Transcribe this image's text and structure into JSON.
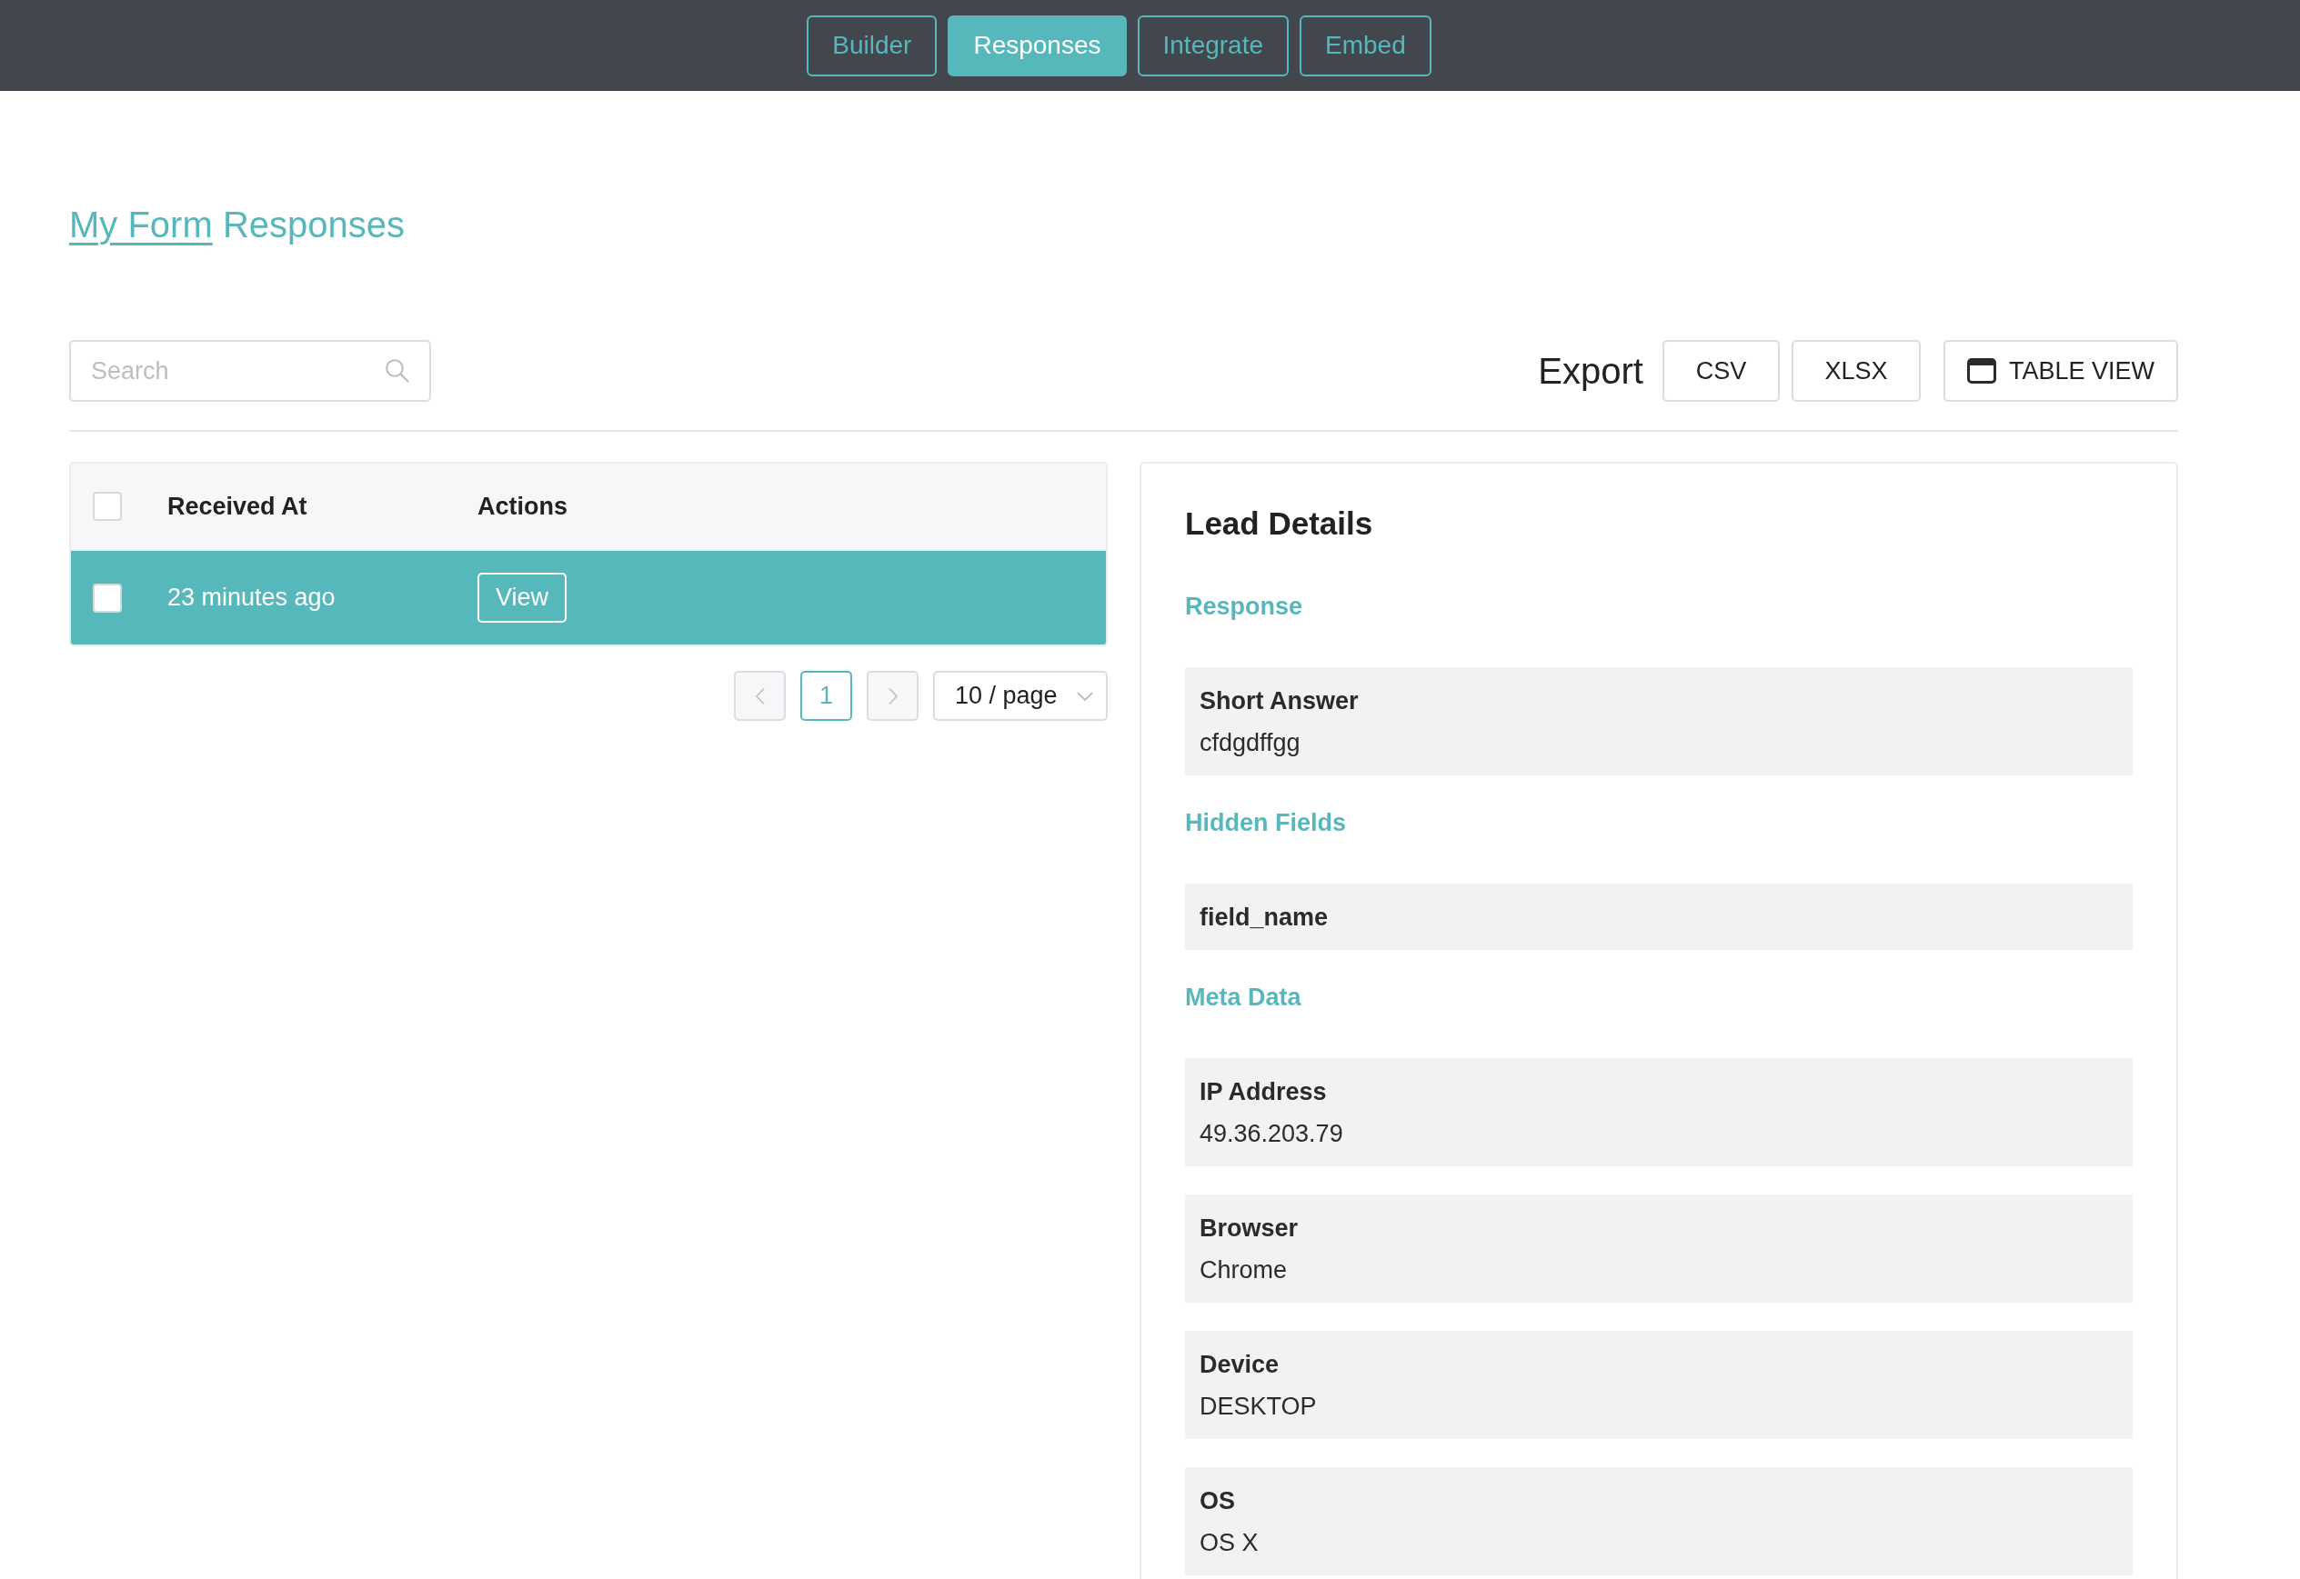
{
  "nav": {
    "tabs": [
      {
        "label": "Builder",
        "selected": false
      },
      {
        "label": "Responses",
        "selected": true
      },
      {
        "label": "Integrate",
        "selected": false
      },
      {
        "label": "Embed",
        "selected": false
      }
    ]
  },
  "header": {
    "form_link": "My Form",
    "title": "Responses"
  },
  "toolbar": {
    "search": {
      "placeholder": "Search"
    },
    "export_label": "Export",
    "export_buttons": [
      "CSV",
      "XLSX"
    ],
    "view_button": "TABLE VIEW"
  },
  "table": {
    "select_all_checked": false,
    "columns": [
      "Received At",
      "Actions"
    ],
    "rows": [
      {
        "received_at": "23 minutes ago",
        "action": "View",
        "checked": false,
        "selected": true
      }
    ]
  },
  "pagination": {
    "previous": {
      "disabled": true
    },
    "pages": [
      {
        "label": "1",
        "selected": true
      }
    ],
    "next": {
      "disabled": true
    },
    "page_size": "10 / page"
  },
  "lead_details": {
    "title": "Lead Details",
    "sections": [
      {
        "heading": "Response",
        "fields": [
          {
            "label": "Short Answer",
            "value": "cfdgdffgg"
          }
        ]
      },
      {
        "heading": "Hidden Fields",
        "fields": [
          {
            "label": "field_name"
          }
        ]
      },
      {
        "heading": "Meta Data",
        "fields": [
          {
            "label": "IP Address",
            "value": "49.36.203.79"
          },
          {
            "label": "Browser",
            "value": "Chrome"
          },
          {
            "label": "Device",
            "value": "DESKTOP"
          },
          {
            "label": "OS",
            "value": "OS X"
          }
        ]
      }
    ]
  }
}
